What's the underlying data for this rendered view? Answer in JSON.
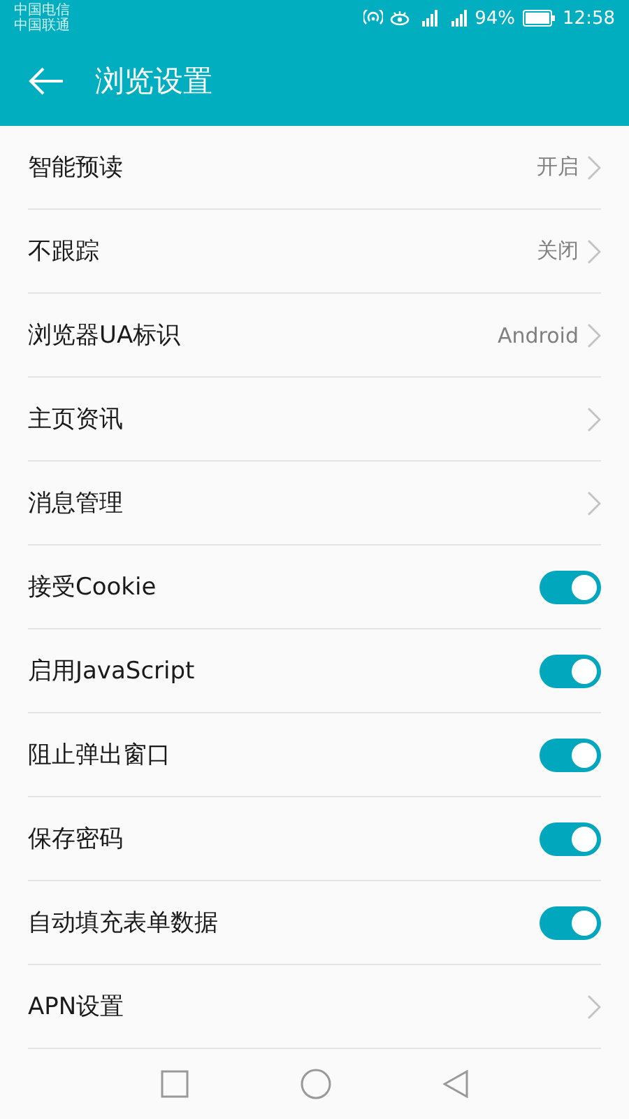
{
  "status_bar": {
    "carriers": [
      "中国电信",
      "中国联通"
    ],
    "battery": "94%",
    "time": "12:58"
  },
  "header": {
    "title": "浏览设置"
  },
  "settings": [
    {
      "kind": "link",
      "label": "智能预读",
      "value": "开启"
    },
    {
      "kind": "link",
      "label": "不跟踪",
      "value": "关闭"
    },
    {
      "kind": "link",
      "label": "浏览器UA标识",
      "value": "Android"
    },
    {
      "kind": "link",
      "label": "主页资讯"
    },
    {
      "kind": "link",
      "label": "消息管理"
    },
    {
      "kind": "toggle",
      "label": "接受Cookie",
      "on": true
    },
    {
      "kind": "toggle",
      "label": "启用JavaScript",
      "on": true
    },
    {
      "kind": "toggle",
      "label": "阻止弹出窗口",
      "on": true
    },
    {
      "kind": "toggle",
      "label": "保存密码",
      "on": true
    },
    {
      "kind": "toggle",
      "label": "自动填充表单数据",
      "on": true
    },
    {
      "kind": "link",
      "label": "APN设置"
    }
  ]
}
